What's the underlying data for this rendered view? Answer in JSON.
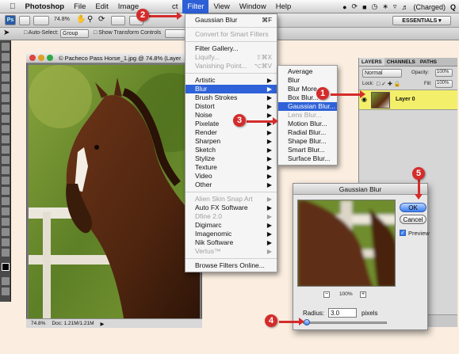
{
  "menubar": {
    "apple": "⌘",
    "items": [
      "Photoshop",
      "File",
      "Edit",
      "Image",
      "Filter",
      "View",
      "Window",
      "Help"
    ],
    "active": "Filter",
    "battery": "(Charged)",
    "search_glyph": "Q"
  },
  "appbar": {
    "zoom": "74.8%",
    "workspace": "ESSENTIALS ▾"
  },
  "options": {
    "auto_select": "Auto-Select:",
    "group": "Group",
    "show_transform": "Show Transform Controls"
  },
  "document": {
    "title": "© Pacheco Pass Horse_1.jpg @ 74.8% (Layer",
    "zoom": "74.8%",
    "doc_size": "Doc: 1.21M/1.21M"
  },
  "filter_menu": {
    "items": [
      {
        "label": "Gaussian Blur",
        "shortcut": "⌘F"
      },
      {
        "sep": true
      },
      {
        "label": "Convert for Smart Filters",
        "disabled": true
      },
      {
        "sep": true
      },
      {
        "label": "Filter Gallery..."
      },
      {
        "label": "Liquify...",
        "shortcut": "⇧⌘X",
        "disabled": true
      },
      {
        "label": "Vanishing Point...",
        "shortcut": "⌥⌘V",
        "disabled": true
      },
      {
        "sep": true
      },
      {
        "label": "Artistic",
        "submenu": true
      },
      {
        "label": "Blur",
        "submenu": true,
        "selected": true
      },
      {
        "label": "Brush Strokes",
        "submenu": true
      },
      {
        "label": "Distort",
        "submenu": true
      },
      {
        "label": "Noise",
        "submenu": true
      },
      {
        "label": "Pixelate",
        "submenu": true
      },
      {
        "label": "Render",
        "submenu": true
      },
      {
        "label": "Sharpen",
        "submenu": true
      },
      {
        "label": "Sketch",
        "submenu": true
      },
      {
        "label": "Stylize",
        "submenu": true
      },
      {
        "label": "Texture",
        "submenu": true
      },
      {
        "label": "Video",
        "submenu": true
      },
      {
        "label": "Other",
        "submenu": true
      },
      {
        "sep": true
      },
      {
        "label": "Alien Skin Snap Art",
        "submenu": true,
        "disabled": true
      },
      {
        "label": "Auto FX Software",
        "submenu": true
      },
      {
        "label": "Dfine 2.0",
        "submenu": true,
        "disabled": true
      },
      {
        "label": "Digimarc",
        "submenu": true
      },
      {
        "label": "Imagenomic",
        "submenu": true
      },
      {
        "label": "Nik Software",
        "submenu": true
      },
      {
        "label": "Vertus™",
        "submenu": true,
        "disabled": true
      },
      {
        "sep": true
      },
      {
        "label": "Browse Filters Online..."
      }
    ]
  },
  "blur_menu": {
    "items": [
      {
        "label": "Average"
      },
      {
        "label": "Blur"
      },
      {
        "label": "Blur More"
      },
      {
        "label": "Box Blur..."
      },
      {
        "label": "Gaussian Blur...",
        "selected": true
      },
      {
        "label": "Lens Blur...",
        "disabled": true
      },
      {
        "label": "Motion Blur..."
      },
      {
        "label": "Radial Blur..."
      },
      {
        "label": "Shape Blur..."
      },
      {
        "label": "Smart Blur..."
      },
      {
        "label": "Surface Blur..."
      }
    ]
  },
  "layers_panel": {
    "tabs": [
      "LAYERS",
      "CHANNELS",
      "PATHS"
    ],
    "blend_mode": "Normal",
    "opacity_label": "Opacity:",
    "opacity": "100%",
    "lock_label": "Lock:",
    "fill_label": "Fill:",
    "fill": "100%",
    "layer_name": "Layer 0"
  },
  "dialog": {
    "title": "Gaussian Blur",
    "ok": "OK",
    "cancel": "Cancel",
    "preview": "Preview",
    "zoom": "100%",
    "radius_label": "Radius:",
    "radius_value": "3.0",
    "radius_unit": "pixels",
    "slider_level": 0.02
  },
  "callouts": [
    "1",
    "2",
    "3",
    "4",
    "5"
  ],
  "colors": {
    "menu_highlight": "#2f62d8",
    "callout_red": "#d42c2b",
    "layer_highlight": "#f3ef6a"
  }
}
